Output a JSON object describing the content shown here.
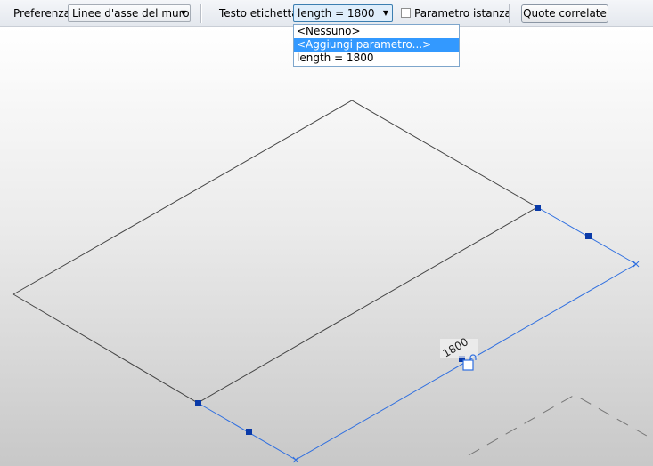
{
  "toolbar": {
    "preference_label": "Preferenza:",
    "preference_value": "Linee d'asse del muro",
    "label_text_label": "Testo etichetta:",
    "label_text_value": "length = 1800",
    "instance_param_label": "Parametro istanza",
    "instance_param_checked": false,
    "related_dims_button": "Quote correlate"
  },
  "dropdown": {
    "options": [
      "<Nessuno>",
      "<Aggiungi parametro...>",
      "length = 1800"
    ],
    "highlighted_index": 1
  },
  "canvas": {
    "dimension_value": "1800"
  },
  "colors": {
    "selection_blue": "#2f6fe0",
    "handle_blue": "#0a3aa8",
    "highlight": "#3399ff"
  }
}
